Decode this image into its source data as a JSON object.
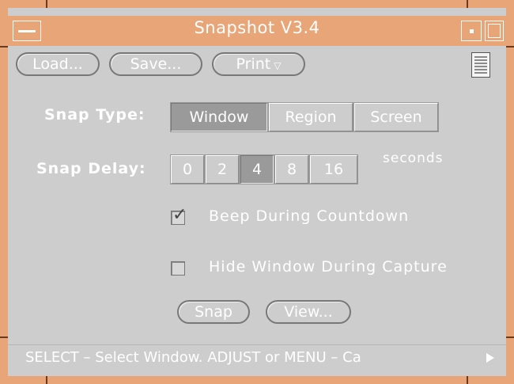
{
  "window": {
    "title": "Snapshot V3.4"
  },
  "toolbar": {
    "load_label": "Load...",
    "save_label": "Save...",
    "print_label": "Print"
  },
  "snap_type": {
    "label": "Snap Type:",
    "options": [
      "Window",
      "Region",
      "Screen"
    ],
    "selected": "Window"
  },
  "snap_delay": {
    "label": "Snap Delay:",
    "options": [
      "0",
      "2",
      "4",
      "8",
      "16"
    ],
    "selected": "4",
    "unit": "seconds"
  },
  "options": {
    "beep_label": "Beep During Countdown",
    "beep_checked": true,
    "hide_label": "Hide Window During Capture",
    "hide_checked": false
  },
  "actions": {
    "snap_label": "Snap",
    "view_label": "View..."
  },
  "footer": {
    "text": "SELECT – Select Window.  ADJUST or MENU – Ca"
  },
  "colors": {
    "frame": "#e8a678",
    "panel": "#cdcdcd",
    "selected": "#9a9a9a"
  }
}
